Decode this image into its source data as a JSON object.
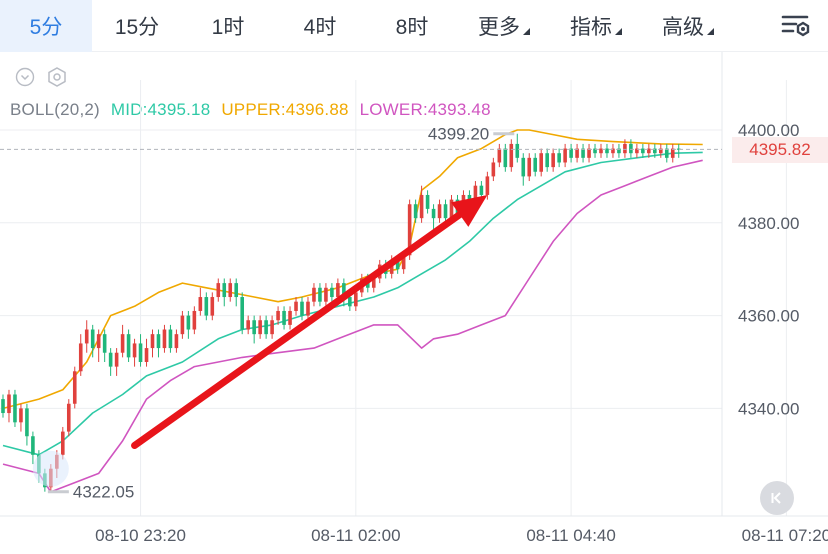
{
  "tabs": [
    {
      "label": "5分",
      "active": true
    },
    {
      "label": "15分",
      "active": false
    },
    {
      "label": "1时",
      "active": false
    },
    {
      "label": "4时",
      "active": false
    },
    {
      "label": "8时",
      "active": false
    },
    {
      "label": "更多",
      "active": false,
      "dropdown": true
    },
    {
      "label": "指标",
      "active": false,
      "dropdown": true
    },
    {
      "label": "高级",
      "active": false,
      "dropdown": true
    }
  ],
  "icons": {
    "settings": "chart-settings-icon",
    "collapse": "chevron-circle-down-icon",
    "indicator_settings": "hexagon-gear-icon",
    "reset": "jump-to-latest-icon"
  },
  "indicator": {
    "name": "BOLL(20,2)",
    "mid": "MID:4395.18",
    "upper": "UPPER:4396.88",
    "lower": "LOWER:4393.48"
  },
  "colors": {
    "up": "#e0413d",
    "down": "#1fb67a",
    "mid": "#2ec9a6",
    "upper": "#f0a800",
    "lower": "#d055c0",
    "arrow": "#e8141a",
    "accent": "#2f7de1"
  },
  "current_price": "4395.82",
  "chart_data": {
    "type": "candlestick",
    "y_ticks": [
      "4400.00",
      "4380.00",
      "4360.00",
      "4340.00"
    ],
    "ylim": [
      4320,
      4405
    ],
    "x_ticks": [
      {
        "index": 23,
        "label": "08-10 23:20"
      },
      {
        "index": 59,
        "label": "08-11 02:00"
      },
      {
        "index": 95,
        "label": "08-11 04:40"
      },
      {
        "index": 131,
        "label": "08-11 07:20"
      }
    ],
    "high_marker": {
      "index": 86,
      "value": 4399.2,
      "label": "4399.20"
    },
    "low_marker": {
      "index": 7,
      "value": 4322.05,
      "label": "4322.05"
    },
    "last_price": 4395.82,
    "candles": [
      [
        4342,
        4339,
        4343,
        4338
      ],
      [
        4339,
        4343,
        4344,
        4337
      ],
      [
        4343,
        4337,
        4344,
        4336
      ],
      [
        4337,
        4340,
        4341,
        4335
      ],
      [
        4340,
        4334,
        4341,
        4332
      ],
      [
        4334,
        4330,
        4335,
        4328
      ],
      [
        4330,
        4326,
        4331,
        4324
      ],
      [
        4326,
        4323,
        4327,
        4322.05
      ],
      [
        4323,
        4327,
        4328,
        4322
      ],
      [
        4327,
        4330,
        4331,
        4325
      ],
      [
        4330,
        4335,
        4336,
        4329
      ],
      [
        4335,
        4341,
        4342,
        4334
      ],
      [
        4341,
        4348,
        4349,
        4340
      ],
      [
        4348,
        4354,
        4356,
        4347
      ],
      [
        4354,
        4357,
        4359,
        4352
      ],
      [
        4357,
        4353,
        4358,
        4351
      ],
      [
        4353,
        4356,
        4357,
        4350
      ],
      [
        4356,
        4352,
        4357,
        4350
      ],
      [
        4352,
        4349,
        4353,
        4347
      ],
      [
        4349,
        4352,
        4353,
        4347
      ],
      [
        4352,
        4356,
        4358,
        4351
      ],
      [
        4356,
        4351,
        4357,
        4350
      ],
      [
        4351,
        4354,
        4355,
        4349
      ],
      [
        4354,
        4350,
        4356,
        4349
      ],
      [
        4350,
        4353,
        4355,
        4349
      ],
      [
        4353,
        4356,
        4357,
        4351
      ],
      [
        4356,
        4353,
        4357,
        4351
      ],
      [
        4353,
        4357,
        4358,
        4352
      ],
      [
        4357,
        4353,
        4358,
        4352
      ],
      [
        4353,
        4356,
        4357,
        4352
      ],
      [
        4356,
        4360,
        4361,
        4355
      ],
      [
        4360,
        4357,
        4361,
        4355
      ],
      [
        4357,
        4361,
        4362,
        4356
      ],
      [
        4361,
        4364,
        4366,
        4360
      ],
      [
        4364,
        4360,
        4365,
        4359
      ],
      [
        4360,
        4364,
        4365,
        4359
      ],
      [
        4364,
        4367,
        4368,
        4363
      ],
      [
        4367,
        4364,
        4368,
        4362
      ],
      [
        4364,
        4367,
        4368,
        4363
      ],
      [
        4367,
        4364,
        4368,
        4362
      ],
      [
        4364,
        4357,
        4365,
        4356
      ],
      [
        4357,
        4359,
        4360,
        4356
      ],
      [
        4359,
        4356,
        4360,
        4354
      ],
      [
        4356,
        4359,
        4360,
        4355
      ],
      [
        4359,
        4356,
        4360,
        4355
      ],
      [
        4356,
        4359,
        4360,
        4355
      ],
      [
        4359,
        4361,
        4362,
        4358
      ],
      [
        4361,
        4358,
        4362,
        4357
      ],
      [
        4358,
        4361,
        4362,
        4357
      ],
      [
        4361,
        4363,
        4364,
        4360
      ],
      [
        4363,
        4360,
        4364,
        4359
      ],
      [
        4360,
        4363,
        4364,
        4359
      ],
      [
        4363,
        4366,
        4367,
        4362
      ],
      [
        4366,
        4363,
        4367,
        4362
      ],
      [
        4363,
        4366,
        4367,
        4362
      ],
      [
        4366,
        4364,
        4367,
        4363
      ],
      [
        4364,
        4367,
        4368,
        4363
      ],
      [
        4367,
        4364,
        4368,
        4362
      ],
      [
        4364,
        4362,
        4365,
        4361
      ],
      [
        4362,
        4365,
        4366,
        4361
      ],
      [
        4365,
        4368,
        4369,
        4364
      ],
      [
        4368,
        4366,
        4369,
        4365
      ],
      [
        4366,
        4368,
        4369,
        4365
      ],
      [
        4368,
        4371,
        4372,
        4367
      ],
      [
        4371,
        4369,
        4372,
        4368
      ],
      [
        4369,
        4372,
        4373,
        4368
      ],
      [
        4372,
        4370,
        4373,
        4369
      ],
      [
        4370,
        4373,
        4374,
        4369
      ],
      [
        4373,
        4384,
        4385,
        4372
      ],
      [
        4384,
        4381,
        4385,
        4380
      ],
      [
        4381,
        4386,
        4388,
        4380
      ],
      [
        4386,
        4383,
        4387,
        4382
      ],
      [
        4383,
        4381,
        4384,
        4378
      ],
      [
        4381,
        4384,
        4385,
        4380
      ],
      [
        4384,
        4381,
        4385,
        4380
      ],
      [
        4381,
        4385,
        4386,
        4380
      ],
      [
        4385,
        4382,
        4386,
        4381
      ],
      [
        4382,
        4386,
        4387,
        4381
      ],
      [
        4386,
        4384,
        4387,
        4383
      ],
      [
        4384,
        4388,
        4389,
        4383
      ],
      [
        4388,
        4386,
        4389,
        4385
      ],
      [
        4386,
        4390,
        4391,
        4385
      ],
      [
        4390,
        4393,
        4394,
        4389
      ],
      [
        4393,
        4396,
        4397,
        4392
      ],
      [
        4396,
        4392,
        4397,
        4391
      ],
      [
        4392,
        4397,
        4398,
        4391
      ],
      [
        4397,
        4394,
        4399.2,
        4393
      ],
      [
        4394,
        4390,
        4395,
        4388
      ],
      [
        4390,
        4394,
        4395,
        4389
      ],
      [
        4394,
        4391,
        4395,
        4390
      ],
      [
        4391,
        4395,
        4396,
        4390
      ],
      [
        4395,
        4392,
        4396,
        4391
      ],
      [
        4392,
        4395,
        4396,
        4391
      ],
      [
        4395,
        4393,
        4396,
        4392
      ],
      [
        4393,
        4396,
        4397,
        4392
      ],
      [
        4396,
        4394,
        4397,
        4393
      ],
      [
        4394,
        4396,
        4397,
        4393
      ],
      [
        4396,
        4394,
        4397,
        4393
      ],
      [
        4394,
        4396,
        4397,
        4393
      ],
      [
        4396,
        4395,
        4397,
        4394
      ],
      [
        4395,
        4396,
        4397,
        4394
      ],
      [
        4396,
        4395,
        4397,
        4394
      ],
      [
        4395,
        4396,
        4397,
        4394
      ],
      [
        4396,
        4395,
        4397,
        4394
      ],
      [
        4395,
        4397,
        4398,
        4394
      ],
      [
        4397,
        4395,
        4398,
        4394
      ],
      [
        4395,
        4396,
        4397,
        4394
      ],
      [
        4396,
        4395,
        4397,
        4394
      ],
      [
        4395,
        4396,
        4397,
        4394
      ],
      [
        4396,
        4395,
        4397,
        4394
      ],
      [
        4395,
        4396,
        4397,
        4394
      ],
      [
        4396,
        4394,
        4397,
        4393
      ],
      [
        4394,
        4396,
        4397,
        4393
      ],
      [
        4396,
        4395.82,
        4397,
        4394
      ]
    ],
    "mid_band": [
      [
        0,
        4332
      ],
      [
        6,
        4330
      ],
      [
        10,
        4333
      ],
      [
        15,
        4339
      ],
      [
        20,
        4343
      ],
      [
        24,
        4347
      ],
      [
        30,
        4350
      ],
      [
        36,
        4355
      ],
      [
        40,
        4357
      ],
      [
        45,
        4358
      ],
      [
        50,
        4360
      ],
      [
        56,
        4362
      ],
      [
        62,
        4364
      ],
      [
        66,
        4366
      ],
      [
        70,
        4369
      ],
      [
        74,
        4372
      ],
      [
        78,
        4376
      ],
      [
        82,
        4381
      ],
      [
        86,
        4385
      ],
      [
        90,
        4388
      ],
      [
        94,
        4391
      ],
      [
        100,
        4393
      ],
      [
        106,
        4394
      ],
      [
        112,
        4395
      ],
      [
        117,
        4395.18
      ]
    ],
    "upper_band": [
      [
        0,
        4340
      ],
      [
        6,
        4342
      ],
      [
        10,
        4344
      ],
      [
        14,
        4350
      ],
      [
        18,
        4360
      ],
      [
        22,
        4362
      ],
      [
        26,
        4365
      ],
      [
        30,
        4367
      ],
      [
        34,
        4366
      ],
      [
        38,
        4365
      ],
      [
        42,
        4364
      ],
      [
        46,
        4363
      ],
      [
        50,
        4364
      ],
      [
        56,
        4366
      ],
      [
        62,
        4369
      ],
      [
        66,
        4370
      ],
      [
        68,
        4375
      ],
      [
        70,
        4387
      ],
      [
        73,
        4390
      ],
      [
        76,
        4394
      ],
      [
        80,
        4396
      ],
      [
        84,
        4399
      ],
      [
        86,
        4400
      ],
      [
        88,
        4400
      ],
      [
        92,
        4399
      ],
      [
        96,
        4398
      ],
      [
        102,
        4397.5
      ],
      [
        110,
        4397
      ],
      [
        117,
        4396.88
      ]
    ],
    "lower_band": [
      [
        0,
        4328
      ],
      [
        6,
        4326
      ],
      [
        8,
        4322
      ],
      [
        12,
        4324
      ],
      [
        16,
        4326
      ],
      [
        20,
        4333
      ],
      [
        24,
        4342
      ],
      [
        28,
        4346
      ],
      [
        32,
        4349
      ],
      [
        36,
        4350
      ],
      [
        40,
        4351
      ],
      [
        46,
        4352
      ],
      [
        52,
        4353
      ],
      [
        56,
        4355
      ],
      [
        62,
        4358
      ],
      [
        66,
        4358
      ],
      [
        70,
        4353
      ],
      [
        72,
        4355
      ],
      [
        76,
        4356
      ],
      [
        80,
        4358
      ],
      [
        84,
        4360
      ],
      [
        88,
        4368
      ],
      [
        92,
        4376
      ],
      [
        96,
        4382
      ],
      [
        100,
        4386
      ],
      [
        104,
        4388
      ],
      [
        108,
        4390
      ],
      [
        112,
        4392
      ],
      [
        117,
        4393.48
      ]
    ],
    "annotation": {
      "type": "trend-arrow",
      "from": [
        22,
        4332
      ],
      "to": [
        81,
        4386
      ]
    }
  }
}
